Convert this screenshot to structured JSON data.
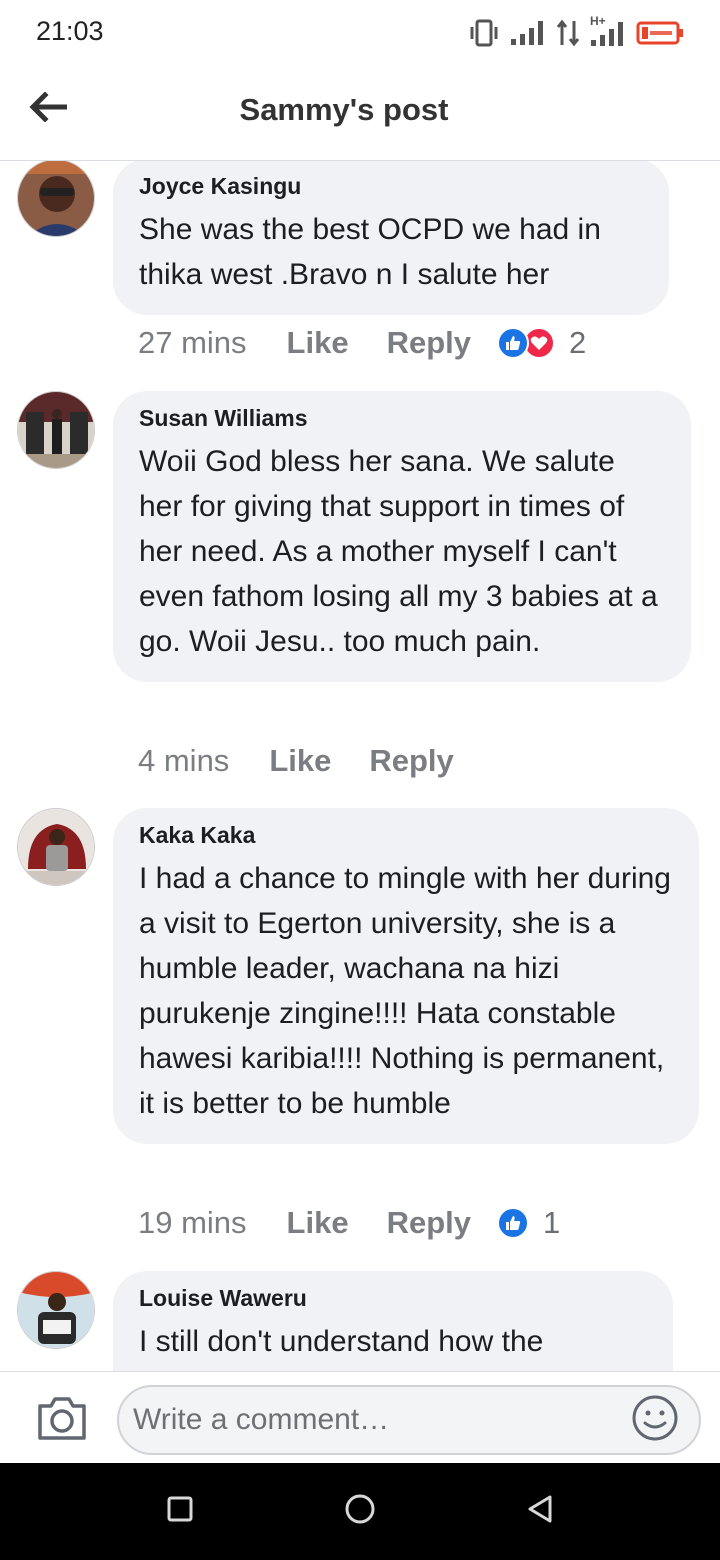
{
  "status_bar": {
    "time": "21:03",
    "icons": [
      "vibrate-icon",
      "signal-icon",
      "data-arrows-icon",
      "network-hplus-icon",
      "battery-low-icon"
    ],
    "network_label": "H+",
    "battery_color": "#e8442c"
  },
  "header": {
    "title": "Sammy's post",
    "back_icon": "back-arrow-icon"
  },
  "comments": [
    {
      "author": "Joyce Kasingu",
      "text": "She was the best OCPD we had in thika west .Bravo n I salute her",
      "time": "27 mins",
      "like_label": "Like",
      "reply_label": "Reply",
      "reactions": [
        "like",
        "love"
      ],
      "reaction_count": "2"
    },
    {
      "author": "Susan Williams",
      "text": "Woii God bless her sana. We salute her for giving that support in times of her need. As a mother myself I can't even fathom losing all my 3 babies at a go. Woii Jesu.. too much pain.",
      "time": "4 mins",
      "like_label": "Like",
      "reply_label": "Reply"
    },
    {
      "author": "Kaka Kaka",
      "text": "I had a chance to mingle with her during a visit to Egerton university, she is a humble leader, wachana na hizi purukenje zingine!!!! Hata constable hawesi karibia!!!! Nothing is permanent, it is better to be humble",
      "time": "19 mins",
      "like_label": "Like",
      "reply_label": "Reply",
      "reactions": [
        "like"
      ],
      "reaction_count": "1"
    },
    {
      "author": "Louise Waweru",
      "text": "I still don't understand how the"
    }
  ],
  "composer": {
    "placeholder": "Write a comment…"
  },
  "colors": {
    "bubble": "#f0f2f5",
    "like_blue": "#1b74e4",
    "love_red": "#f0284a",
    "meta_gray": "#7a7d82"
  }
}
